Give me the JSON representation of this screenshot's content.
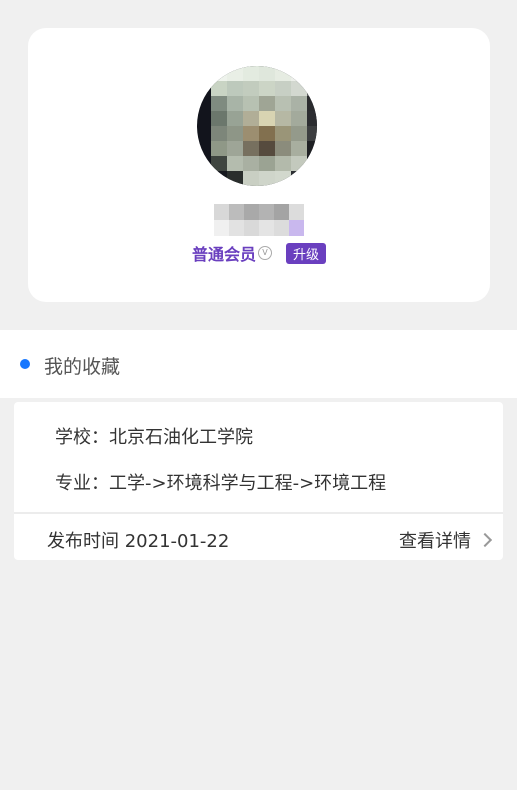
{
  "profile": {
    "member_level": "普通会员",
    "member_icon": "v-badge-icon",
    "upgrade_label": "升级",
    "accent_color": "#6a3fbf"
  },
  "favorites": {
    "title": "我的收藏",
    "dot_color": "#1677ff"
  },
  "item": {
    "school": "学校：北京石油化工学院",
    "major": "专业：工学->环境科学与工程->环境工程",
    "publish_date": "发布时间 2021-01-22",
    "details_label": "查看详情",
    "details_icon": "chevron-right-icon"
  }
}
